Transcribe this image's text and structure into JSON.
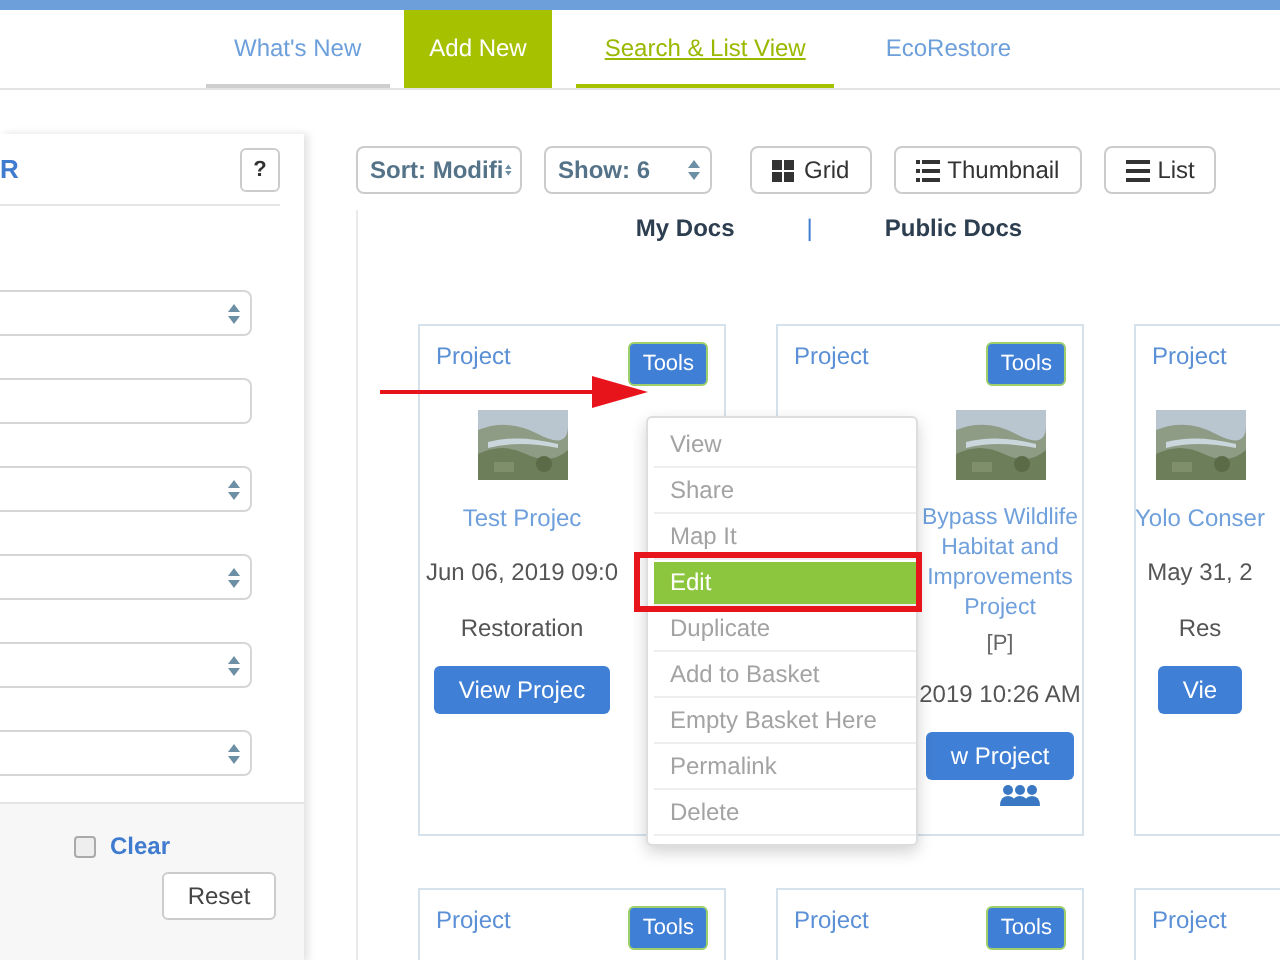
{
  "nav": {
    "tabs": [
      {
        "label": "What's New",
        "kind": "tab",
        "selected": false
      },
      {
        "label": "Add New",
        "kind": "action",
        "selected": false
      },
      {
        "label": "Search & List View",
        "kind": "tab",
        "selected": true
      },
      {
        "label": "EcoRestore",
        "kind": "tab",
        "selected": false
      }
    ]
  },
  "filter_panel": {
    "title": "R",
    "help": "?",
    "fields": [
      {
        "kind": "select"
      },
      {
        "kind": "input"
      },
      {
        "kind": "select"
      },
      {
        "kind": "select"
      },
      {
        "kind": "select"
      },
      {
        "kind": "select"
      }
    ],
    "clear": {
      "label": "Clear",
      "checked": false
    },
    "reset": "Reset"
  },
  "toolbar": {
    "sort": "Sort: Modifi",
    "show": "Show: 6",
    "views": [
      {
        "kind": "grid",
        "label": "Grid"
      },
      {
        "kind": "thumbnail",
        "label": "Thumbnail"
      },
      {
        "kind": "list",
        "label": "List"
      }
    ]
  },
  "doc_tabs": {
    "items": [
      "My Docs",
      "Public Docs"
    ],
    "separator": "|"
  },
  "cards": [
    {
      "label": "Project",
      "tools": "Tools",
      "picture": true,
      "title": "Test Projec",
      "date": "Jun 06, 2019 09:0",
      "type": "Restoration",
      "button": "View Projec",
      "kind": "covered-right"
    },
    {
      "label": "Project",
      "tools": "Tools",
      "picture": true,
      "title": "Bypass Wildlife Habitat and Improvements Project",
      "tag": "[P]",
      "date": "2019 10:26 AM",
      "button": "w Project",
      "group": true,
      "kind": "covered-left"
    },
    {
      "label": "Project",
      "picture": true,
      "title": "Yolo Conser",
      "date": "May 31, 2",
      "type": "Res",
      "button": "Vie",
      "kind": "cut-at-edge"
    },
    {
      "label": "Project",
      "tools": "Tools"
    },
    {
      "label": "Project",
      "tools": "Tools"
    },
    {
      "label": "Project"
    }
  ],
  "tools_menu": {
    "items": [
      {
        "label": "View",
        "selected": false
      },
      {
        "label": "Share",
        "selected": false
      },
      {
        "label": "Map It",
        "selected": false
      },
      {
        "label": "Edit",
        "selected": true
      },
      {
        "label": "Duplicate",
        "selected": false
      },
      {
        "label": "Add to Basket",
        "selected": false
      },
      {
        "label": "Empty Basket Here",
        "selected": false
      },
      {
        "label": "Permalink",
        "selected": false
      },
      {
        "label": "Delete",
        "selected": false
      }
    ]
  }
}
